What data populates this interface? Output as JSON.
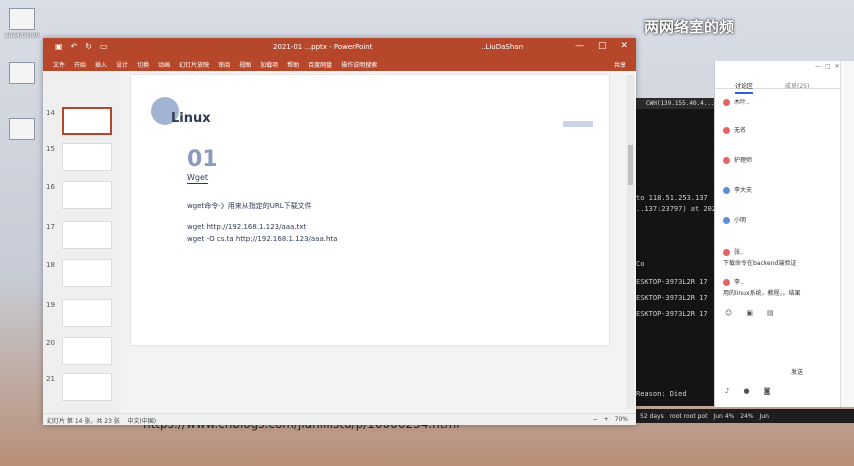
{
  "desktop": {
    "icons": [
      {
        "label": "2024/01/09"
      },
      {
        "label": ""
      },
      {
        "label": ""
      }
    ],
    "watermark": "两网络室的频"
  },
  "ppt": {
    "titlebar": {
      "doc_title": "2021-01 ...pptx - PowerPoint",
      "user": "..LiuDaShan",
      "controls": {
        "minimize": "—",
        "maximize": "□",
        "close": "✕"
      }
    },
    "ribbon": {
      "tabs": [
        "文件",
        "开始",
        "插入",
        "设计",
        "切换",
        "动画",
        "幻灯片放映",
        "审阅",
        "视图",
        "加载项",
        "帮助",
        "百度网盘",
        "操作说明搜索"
      ],
      "share": "共享"
    },
    "thumbnails": [
      {
        "num": "14"
      },
      {
        "num": "15"
      },
      {
        "num": "16"
      },
      {
        "num": "17"
      },
      {
        "num": "18"
      },
      {
        "num": "19"
      },
      {
        "num": "20"
      },
      {
        "num": "21"
      }
    ],
    "slide": {
      "title": "Linux",
      "number": "01",
      "subtitle": "Wget",
      "lines": [
        "wget命令-》用来从指定的URL下载文件",
        "wget http://192.168.1.123/aaa.txt",
        "wget -O cs.ta http://192.168.1.123/aaa.hta"
      ]
    },
    "url": "https://www.cnblogs.com/jianlilistu/p/10006234.html",
    "status": {
      "left": "幻灯片 第 14 张，共 23 张",
      "lang": "中文(中国)",
      "zoom": "70%"
    }
  },
  "terminal": {
    "title": "CWH(139.155.40.4...)",
    "lines": [
      "to 118.51.253.137",
      "..137:23797) at 202",
      "Co",
      "ESKTOP-3973L2R  17",
      "ESKTOP-3973L2R  17",
      "ESKTOP-3973L2R  17",
      "Reason: Died"
    ],
    "taskbar": [
      "52 days",
      "root root pot",
      "Jun 4%",
      "24%",
      "Jun"
    ]
  },
  "chat": {
    "tabs": {
      "discussion": "讨论区",
      "members": "成员(25)"
    },
    "messages": [
      {
        "user": "木叶..",
        "text": ""
      },
      {
        "user": "无名",
        "text": ""
      },
      {
        "user": "护理师",
        "text": ""
      },
      {
        "user": "李大夫",
        "text": ""
      },
      {
        "user": "小明",
        "text": ""
      },
      {
        "user": "张..",
        "text": "下载命令在backend端验证"
      },
      {
        "user": "李..",
        "text": "用的linux系统，教程。。结果"
      }
    ],
    "send_label": "发送"
  }
}
